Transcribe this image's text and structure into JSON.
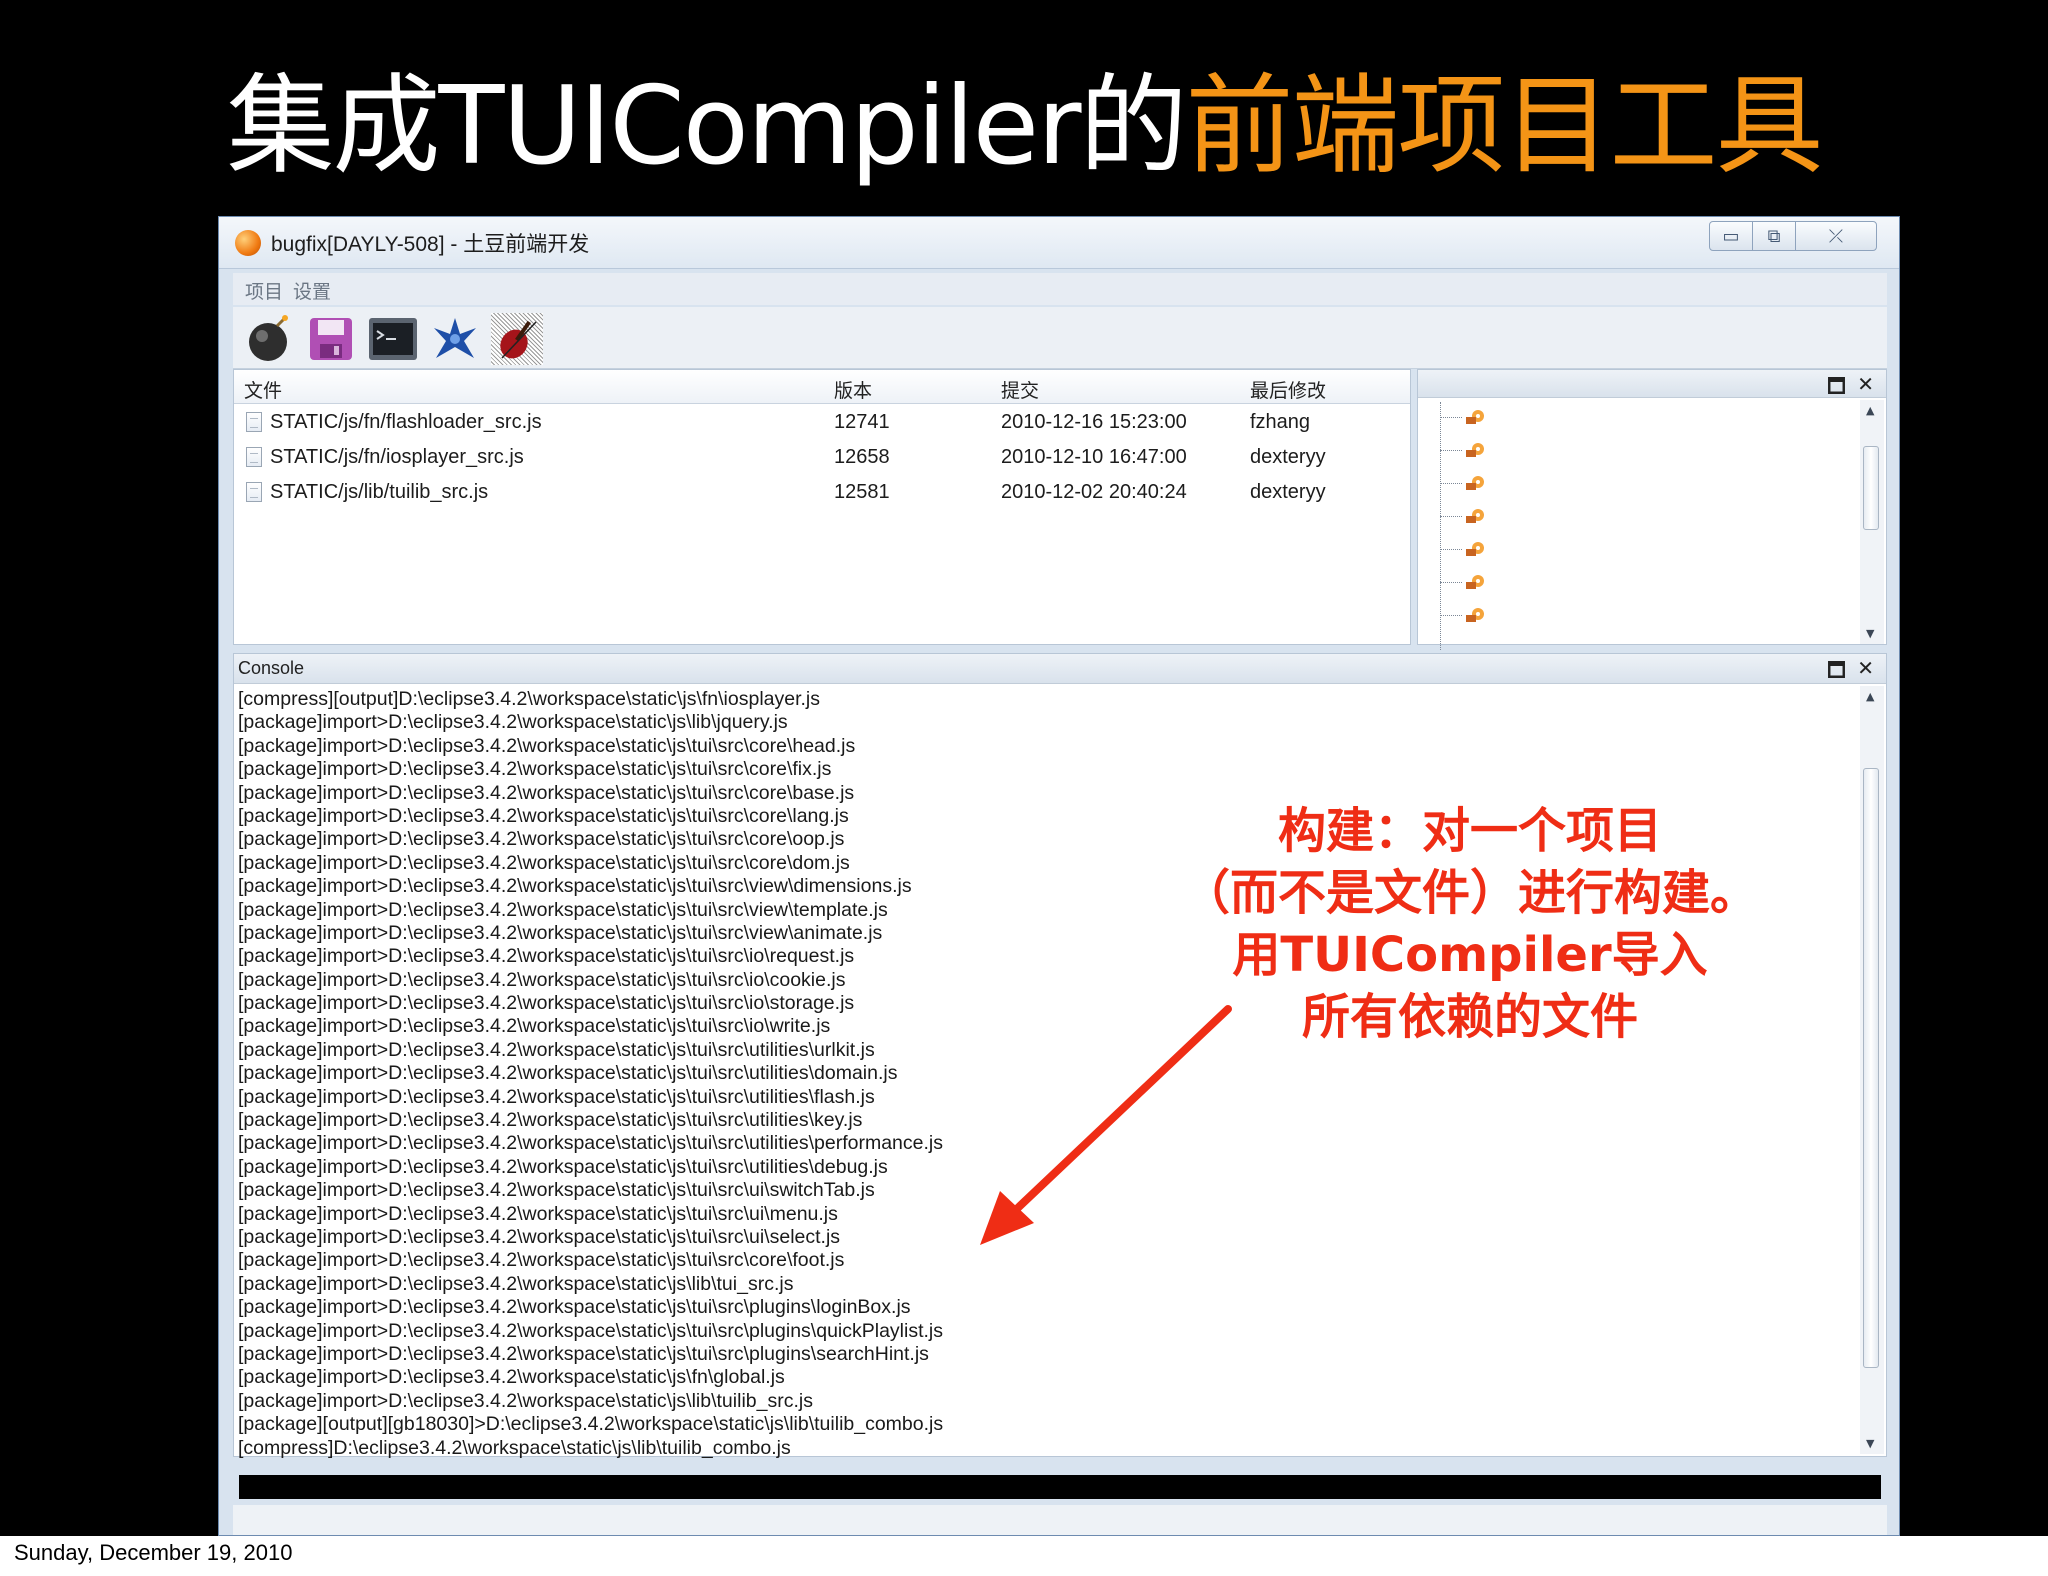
{
  "slide": {
    "title_white_1": "集成TUICompiler的",
    "title_orange": "前端项目工具",
    "date": "Sunday, December 19, 2010"
  },
  "window": {
    "title": "bugfix[DAYLY-508] - 土豆前端开发",
    "buttons": {
      "minimize": "▭",
      "maximize": "⧉",
      "close": "⤫"
    }
  },
  "menu": {
    "project": "项目",
    "settings": "设置"
  },
  "toolbar": {
    "icons": [
      "bomb-icon",
      "save-icon",
      "terminal-icon",
      "star-figure-icon",
      "violin-icon"
    ]
  },
  "file_table": {
    "headers": {
      "file": "文件",
      "version": "版本",
      "commit": "提交",
      "modified_by": "最后修改"
    },
    "rows": [
      {
        "file": "STATIC/js/fn/flashloader_src.js",
        "version": "12741",
        "commit": "2010-12-16 15:23:00",
        "modified_by": "fzhang"
      },
      {
        "file": "STATIC/js/fn/iosplayer_src.js",
        "version": "12658",
        "commit": "2010-12-10 16:47:00",
        "modified_by": "dexteryy"
      },
      {
        "file": "STATIC/js/lib/tuilib_src.js",
        "version": "12581",
        "commit": "2010-12-02 20:40:24",
        "modified_by": "dexteryy"
      }
    ]
  },
  "panel_controls": {
    "restore": "🗖",
    "close": "✕"
  },
  "console": {
    "title": "Console",
    "lines": [
      "[compress][output]D:\\eclipse3.4.2\\workspace\\static\\js\\fn\\iosplayer.js",
      "[package]import>D:\\eclipse3.4.2\\workspace\\static\\js\\lib\\jquery.js",
      "[package]import>D:\\eclipse3.4.2\\workspace\\static\\js\\tui\\src\\core\\head.js",
      "[package]import>D:\\eclipse3.4.2\\workspace\\static\\js\\tui\\src\\core\\fix.js",
      "[package]import>D:\\eclipse3.4.2\\workspace\\static\\js\\tui\\src\\core\\base.js",
      "[package]import>D:\\eclipse3.4.2\\workspace\\static\\js\\tui\\src\\core\\lang.js",
      "[package]import>D:\\eclipse3.4.2\\workspace\\static\\js\\tui\\src\\core\\oop.js",
      "[package]import>D:\\eclipse3.4.2\\workspace\\static\\js\\tui\\src\\core\\dom.js",
      "[package]import>D:\\eclipse3.4.2\\workspace\\static\\js\\tui\\src\\view\\dimensions.js",
      "[package]import>D:\\eclipse3.4.2\\workspace\\static\\js\\tui\\src\\view\\template.js",
      "[package]import>D:\\eclipse3.4.2\\workspace\\static\\js\\tui\\src\\view\\animate.js",
      "[package]import>D:\\eclipse3.4.2\\workspace\\static\\js\\tui\\src\\io\\request.js",
      "[package]import>D:\\eclipse3.4.2\\workspace\\static\\js\\tui\\src\\io\\cookie.js",
      "[package]import>D:\\eclipse3.4.2\\workspace\\static\\js\\tui\\src\\io\\storage.js",
      "[package]import>D:\\eclipse3.4.2\\workspace\\static\\js\\tui\\src\\io\\write.js",
      "[package]import>D:\\eclipse3.4.2\\workspace\\static\\js\\tui\\src\\utilities\\urlkit.js",
      "[package]import>D:\\eclipse3.4.2\\workspace\\static\\js\\tui\\src\\utilities\\domain.js",
      "[package]import>D:\\eclipse3.4.2\\workspace\\static\\js\\tui\\src\\utilities\\flash.js",
      "[package]import>D:\\eclipse3.4.2\\workspace\\static\\js\\tui\\src\\utilities\\key.js",
      "[package]import>D:\\eclipse3.4.2\\workspace\\static\\js\\tui\\src\\utilities\\performance.js",
      "[package]import>D:\\eclipse3.4.2\\workspace\\static\\js\\tui\\src\\utilities\\debug.js",
      "[package]import>D:\\eclipse3.4.2\\workspace\\static\\js\\tui\\src\\ui\\switchTab.js",
      "[package]import>D:\\eclipse3.4.2\\workspace\\static\\js\\tui\\src\\ui\\menu.js",
      "[package]import>D:\\eclipse3.4.2\\workspace\\static\\js\\tui\\src\\ui\\select.js",
      "[package]import>D:\\eclipse3.4.2\\workspace\\static\\js\\tui\\src\\core\\foot.js",
      "[package]import>D:\\eclipse3.4.2\\workspace\\static\\js\\lib\\tui_src.js",
      "[package]import>D:\\eclipse3.4.2\\workspace\\static\\js\\tui\\src\\plugins\\loginBox.js",
      "[package]import>D:\\eclipse3.4.2\\workspace\\static\\js\\tui\\src\\plugins\\quickPlaylist.js",
      "[package]import>D:\\eclipse3.4.2\\workspace\\static\\js\\tui\\src\\plugins\\searchHint.js",
      "[package]import>D:\\eclipse3.4.2\\workspace\\static\\js\\fn\\global.js",
      "[package]import>D:\\eclipse3.4.2\\workspace\\static\\js\\lib\\tuilib_src.js",
      "[package][output][gb18030]>D:\\eclipse3.4.2\\workspace\\static\\js\\lib\\tuilib_combo.js",
      "[compress]D:\\eclipse3.4.2\\workspace\\static\\js\\lib\\tuilib_combo.js"
    ]
  },
  "annotation": {
    "lines": [
      "构建：对一个项目",
      "（而不是文件）进行构建。",
      "用TUICompiler导入",
      "所有依赖的文件"
    ],
    "color": "#ef2d15"
  },
  "colors": {
    "title_white": "#ffffff",
    "title_orange": "#f49416",
    "slide_bg": "#000000"
  }
}
